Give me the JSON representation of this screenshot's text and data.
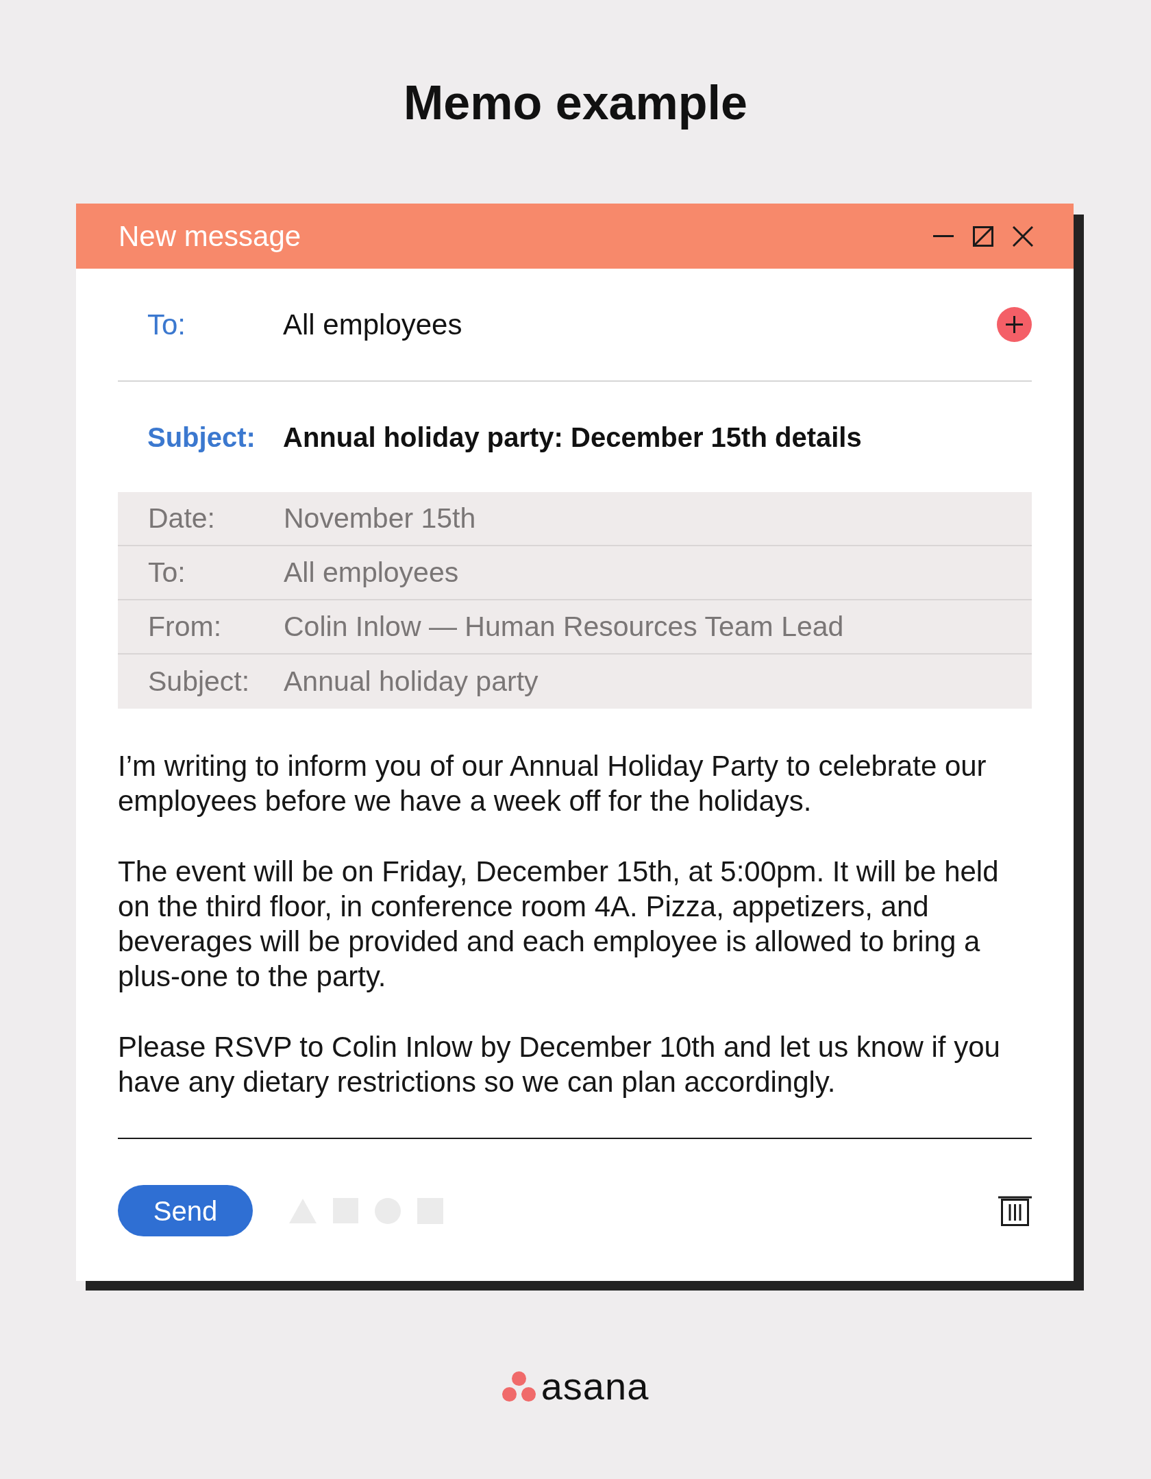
{
  "page": {
    "title": "Memo example"
  },
  "window": {
    "title": "New message"
  },
  "fields": [
    {
      "kind": "recipient",
      "label": "To:",
      "value": "All employees"
    },
    {
      "kind": "subject",
      "label": "Subject:",
      "value": "Annual holiday party: December 15th details"
    }
  ],
  "memo_header": [
    {
      "label": "Date:",
      "value": "November 15th"
    },
    {
      "label": "To:",
      "value": "All employees"
    },
    {
      "label": "From:",
      "value": "Colin Inlow — Human Resources Team Lead"
    },
    {
      "label": "Subject:",
      "value": "Annual holiday party"
    }
  ],
  "body": [
    "I’m writing to inform you of our Annual Holiday Party to celebrate our employees before we have a week off for the holidays.",
    "The event will be on Friday, December 15th, at 5:00pm. It will be held on the third floor, in conference room 4A. Pizza, appetizers, and beverages will be provided and each employee is allowed to bring a plus-one to the party.",
    "Please RSVP to Colin Inlow by December 10th and let us know if you have any dietary restrictions so we can plan accordingly."
  ],
  "toolbar": {
    "send": "Send"
  },
  "footer": {
    "logo": "asana"
  }
}
